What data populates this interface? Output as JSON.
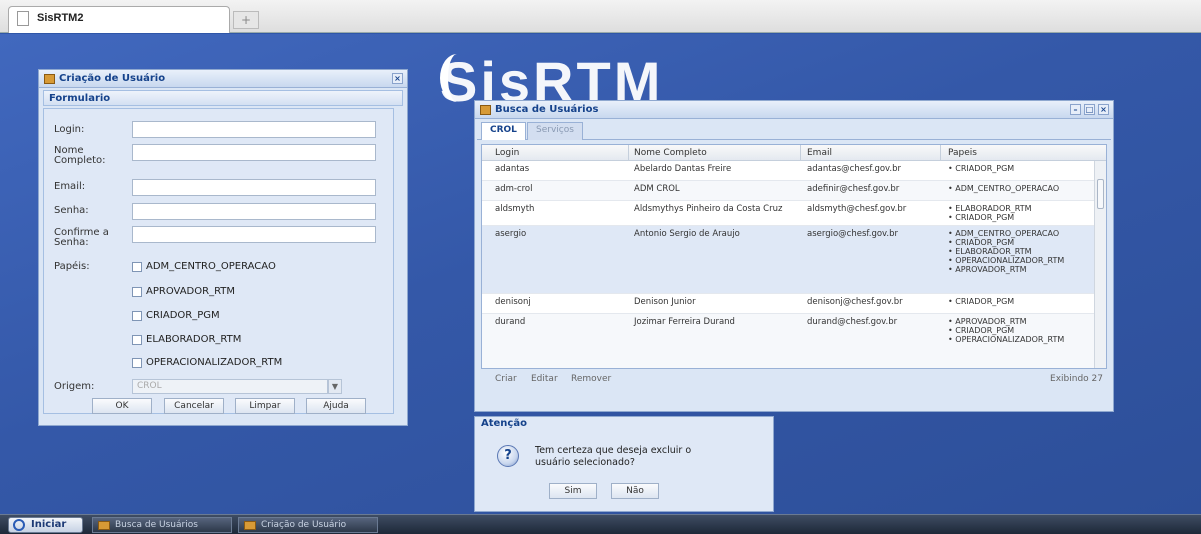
{
  "browser": {
    "tab_title": "SisRTM2",
    "new_tab": "+"
  },
  "logo": {
    "text": "SisRTM"
  },
  "create_user_window": {
    "title": "Criação de Usuário",
    "close": "×",
    "section": "Formulario",
    "fields": {
      "login": {
        "label": "Login:",
        "value": ""
      },
      "nome_completo": {
        "label_line1": "Nome",
        "label_line2": "Completo:",
        "value": ""
      },
      "email": {
        "label": "Email:",
        "value": ""
      },
      "senha": {
        "label": "Senha:",
        "value": ""
      },
      "confirme_senha": {
        "label_line1": "Confirme a",
        "label_line2": "Senha:",
        "value": ""
      }
    },
    "papeis_label": "Papéis:",
    "papeis": [
      {
        "label": "ADM_CENTRO_OPERACAO",
        "checked": false
      },
      {
        "label": "APROVADOR_RTM",
        "checked": false
      },
      {
        "label": "CRIADOR_PGM",
        "checked": false
      },
      {
        "label": "ELABORADOR_RTM",
        "checked": false
      },
      {
        "label": "OPERACIONALIZADOR_RTM",
        "checked": false
      }
    ],
    "origem_label": "Origem:",
    "origem_value": "CROL",
    "buttons": {
      "ok": "OK",
      "cancelar": "Cancelar",
      "limpar": "Limpar",
      "ajuda": "Ajuda"
    }
  },
  "users_window": {
    "title": "Busca de Usuários",
    "controls": {
      "minimize": "–",
      "maximize": "□",
      "close": "×"
    },
    "tabs": [
      {
        "label": "CROL",
        "active": true
      },
      {
        "label": "Serviços",
        "active": false
      }
    ],
    "columns": {
      "login": "Login",
      "nome": "Nome Completo",
      "email": "Email",
      "papeis": "Papeis"
    },
    "rows": [
      {
        "login": "adantas",
        "nome": "Abelardo Dantas Freire",
        "email": "adantas@chesf.gov.br",
        "papeis": [
          "CRIADOR_PGM"
        ]
      },
      {
        "login": "adm-crol",
        "nome": "ADM CROL",
        "email": "adefinir@chesf.gov.br",
        "papeis": [
          "ADM_CENTRO_OPERACAO"
        ]
      },
      {
        "login": "aldsmyth",
        "nome": "Aldsmythys Pinheiro da Costa Cruz",
        "email": "aldsmyth@chesf.gov.br",
        "papeis": [
          "ELABORADOR_RTM",
          "CRIADOR_PGM"
        ]
      },
      {
        "login": "asergio",
        "nome": "Antonio Sergio de Araujo",
        "email": "asergio@chesf.gov.br",
        "papeis": [
          "ADM_CENTRO_OPERACAO",
          "CRIADOR_PGM",
          "ELABORADOR_RTM",
          "OPERACIONALIZADOR_RTM",
          "APROVADOR_RTM"
        ]
      },
      {
        "login": "denisonj",
        "nome": "Denison Junior",
        "email": "denisonj@chesf.gov.br",
        "papeis": [
          "CRIADOR_PGM"
        ]
      },
      {
        "login": "durand",
        "nome": "Jozimar Ferreira Durand",
        "email": "durand@chesf.gov.br",
        "papeis": [
          "APROVADOR_RTM",
          "CRIADOR_PGM",
          "OPERACIONALIZADOR_RTM"
        ]
      }
    ],
    "footer": {
      "criar": "Criar",
      "editar": "Editar",
      "remover": "Remover",
      "status": "Exibindo 27"
    }
  },
  "dialog": {
    "title": "Atenção",
    "icon": "?",
    "message_line1": "Tem certeza que deseja excluir o",
    "message_line2": "usuário selecionado?",
    "yes": "Sim",
    "no": "Não"
  },
  "taskbar": {
    "start": "Iniciar",
    "tasks": [
      "Busca de Usuários",
      "Criação de Usuário"
    ]
  }
}
